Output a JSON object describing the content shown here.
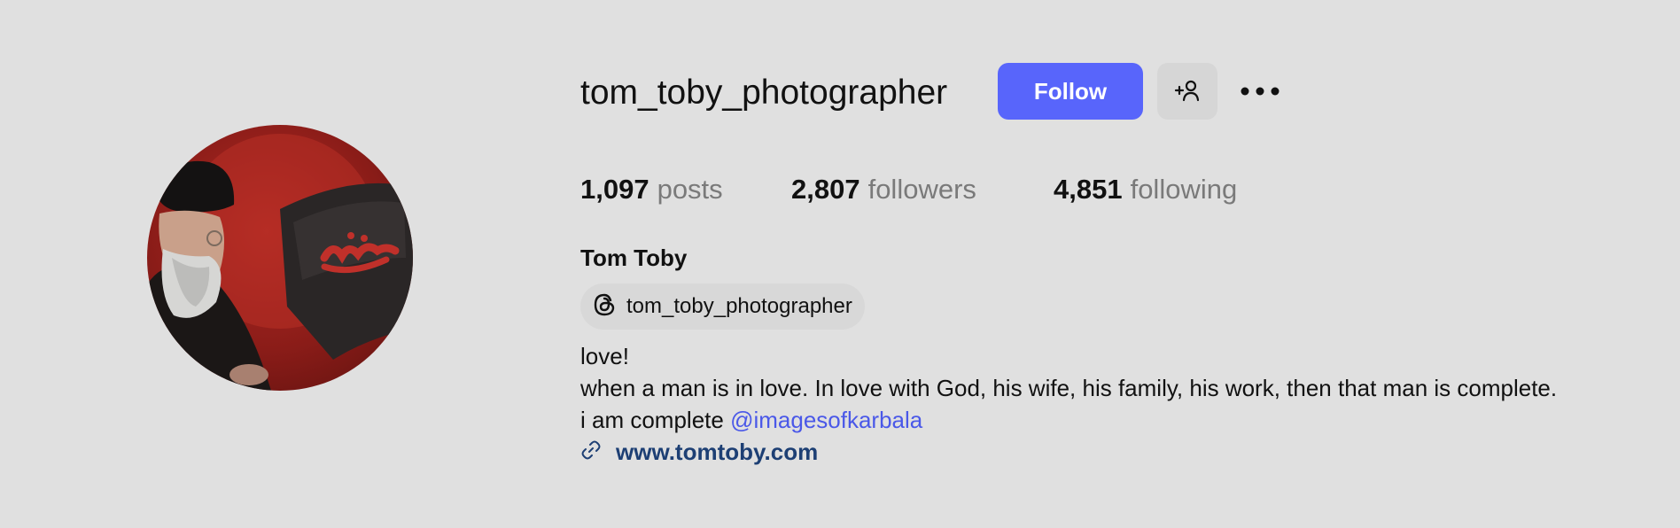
{
  "profile": {
    "username": "tom_toby_photographer",
    "full_name": "Tom Toby",
    "follow_label": "Follow",
    "avatar_alt": "profile picture"
  },
  "stats": {
    "posts": {
      "count": "1,097",
      "label": "posts"
    },
    "followers": {
      "count": "2,807",
      "label": "followers"
    },
    "following": {
      "count": "4,851",
      "label": "following"
    }
  },
  "threads": {
    "handle": "tom_toby_photographer"
  },
  "bio": {
    "line1": "love!",
    "line2": "when a man is in love. In love with God, his wife, his family, his work, then that man is complete.",
    "line3_text": "i am complete ",
    "line3_mention": "@imagesofkarbala"
  },
  "website": {
    "url": "www.tomtoby.com"
  },
  "icons": {
    "add_user": "add-user-icon",
    "more": "more-horizontal-icon",
    "threads": "threads-icon",
    "link": "link-icon"
  },
  "colors": {
    "background": "#e0e0e0",
    "accent": "#5865fb",
    "mention": "#4a58e8",
    "link": "#1d3f74",
    "muted": "#7a7a7a"
  }
}
